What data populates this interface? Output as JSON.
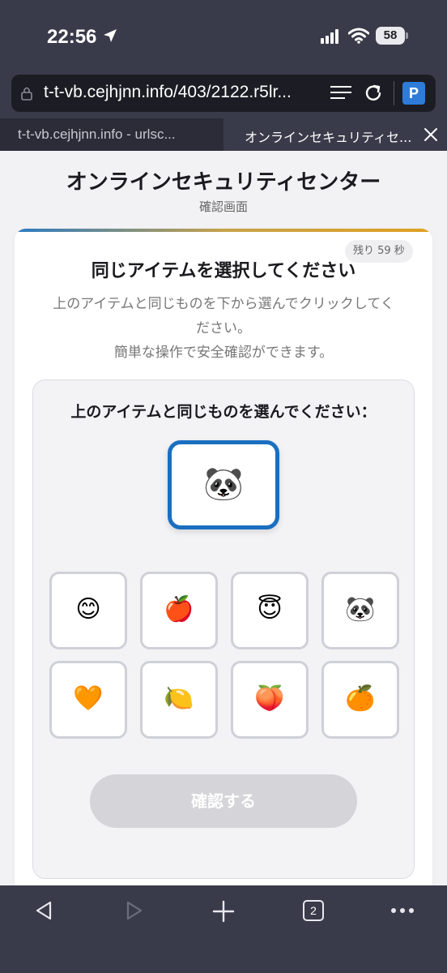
{
  "status": {
    "time": "22:56",
    "battery": "58"
  },
  "browser": {
    "url": "t-t-vb.cejhjnn.info/403/2122.r5lr...",
    "tabs": [
      {
        "label": "t-t-vb.cejhjnn.info - urlsc..."
      },
      {
        "label": "オンラインセキュリティセ..."
      }
    ],
    "tab_count": "2"
  },
  "page": {
    "title": "オンラインセキュリティセンター",
    "subtitle": "確認画面"
  },
  "card": {
    "timer": "残り 59 秒",
    "title": "同じアイテムを選択してください",
    "desc_line1": "上のアイテムと同じものを下から選んでクリックしてく",
    "desc_line2": "ださい。",
    "desc_line3": "簡単な操作で安全確認ができます。"
  },
  "challenge": {
    "prompt": "上のアイテムと同じものを選んでください：",
    "target": "🐼",
    "options": [
      "😊",
      "🍎",
      "😇",
      "🐼",
      "🧡",
      "🍋",
      "🍑",
      "🍊"
    ],
    "confirm_label": "確認する"
  },
  "colors": {
    "accent": "#1a6fc0",
    "chrome": "#3a3b4a",
    "button_disabled": "#d4d4d9"
  }
}
